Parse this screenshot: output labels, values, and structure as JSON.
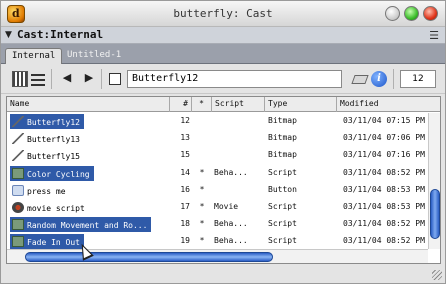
{
  "window": {
    "title": "butterfly: Cast"
  },
  "cast_header": {
    "label": "Cast:Internal"
  },
  "tabs": [
    {
      "label": "Internal",
      "active": true
    },
    {
      "label": "Untitled-1",
      "active": false
    }
  ],
  "toolbar": {
    "member_name": "Butterfly12",
    "member_number": "12"
  },
  "columns": [
    "Name",
    "#",
    "*",
    "Script",
    "Type",
    "Modified"
  ],
  "rows": [
    {
      "name": "Butterfly12",
      "num": "12",
      "star": "",
      "script": "",
      "type": "Bitmap",
      "modified": "03/11/04 07:15 PM",
      "icon": "bitmap-icon",
      "selected": true
    },
    {
      "name": "Butterfly13",
      "num": "13",
      "star": "",
      "script": "",
      "type": "Bitmap",
      "modified": "03/11/04 07:06 PM",
      "icon": "bitmap-icon",
      "selected": false
    },
    {
      "name": "Butterfly15",
      "num": "15",
      "star": "",
      "script": "",
      "type": "Bitmap",
      "modified": "03/11/04 07:16 PM",
      "icon": "bitmap-icon",
      "selected": false
    },
    {
      "name": "Color Cycling",
      "num": "14",
      "star": "*",
      "script": "Beha...",
      "type": "Script",
      "modified": "03/11/04 08:52 PM",
      "icon": "behavior-icon",
      "selected": true
    },
    {
      "name": "press me",
      "num": "16",
      "star": "*",
      "script": "",
      "type": "Button",
      "modified": "03/11/04 08:53 PM",
      "icon": "button-icon",
      "selected": false
    },
    {
      "name": "movie script",
      "num": "17",
      "star": "*",
      "script": "Movie",
      "type": "Script",
      "modified": "03/11/04 08:53 PM",
      "icon": "movie-script-icon",
      "selected": false
    },
    {
      "name": "Random Movement and Ro...",
      "num": "18",
      "star": "*",
      "script": "Beha...",
      "type": "Script",
      "modified": "03/11/04 08:52 PM",
      "icon": "behavior-icon",
      "selected": true
    },
    {
      "name": "Fade In Out",
      "num": "19",
      "star": "*",
      "script": "Beha...",
      "type": "Script",
      "modified": "03/11/04 08:52 PM",
      "icon": "behavior-icon",
      "selected": true
    }
  ],
  "colors": {
    "selection": "#2f5aa8",
    "scroll_thumb": "#2b5ec5"
  }
}
